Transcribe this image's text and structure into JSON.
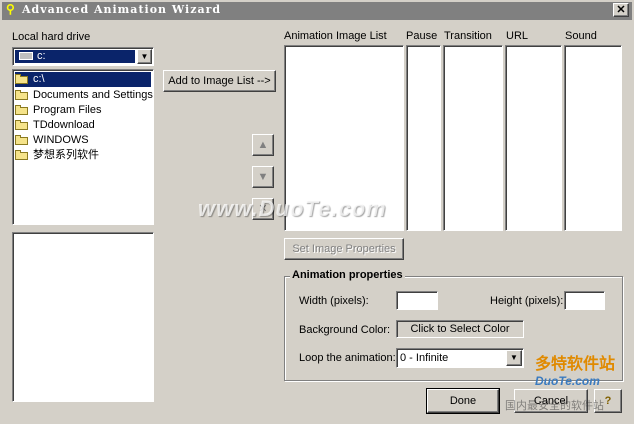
{
  "window": {
    "title": "Advanced Animation Wizard",
    "close_glyph": "✕"
  },
  "left": {
    "drive_label": "Local hard drive",
    "drive_value": "c:",
    "tree": [
      "c:\\",
      "Documents and Settings",
      "Program Files",
      "TDdownload",
      "WINDOWS",
      "梦想系列软件"
    ]
  },
  "add_button": "Add to Image List -->",
  "arrows": {
    "up": "▲",
    "down": "▼",
    "delete": "✕"
  },
  "columns": {
    "image_list": "Animation Image List",
    "pause": "Pause",
    "transition": "Transition",
    "url": "URL",
    "sound": "Sound"
  },
  "set_props_button": "Set Image Properties",
  "props": {
    "title": "Animation properties",
    "width_label": "Width (pixels):",
    "height_label": "Height (pixels):",
    "width_value": "",
    "height_value": "",
    "bg_label": "Background Color:",
    "bg_button": "Click to Select Color",
    "loop_label": "Loop the animation:",
    "loop_value": "0 - Infinite"
  },
  "buttons": {
    "done": "Done",
    "cancel": "Cancel",
    "help": "?"
  },
  "watermarks": {
    "center": "www.DuoTe.com",
    "corner_brand": "多特软件站",
    "corner_url": "DuoTe.com",
    "corner_tag": "国内最安全的软件站"
  }
}
